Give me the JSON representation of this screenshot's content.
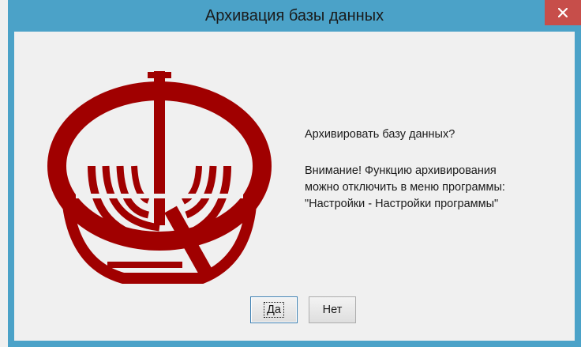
{
  "window": {
    "title": "Архивация базы данных",
    "close_icon": "close-icon"
  },
  "logo": {
    "icon": "database-archive-emblem",
    "color": "#a00000"
  },
  "message": {
    "question": "Архивировать базу данных?",
    "warning_lines": [
      "Внимание! Функцию архивирования",
      "можно отключить в меню программы:",
      "\"Настройки - Настройки программы\""
    ]
  },
  "buttons": {
    "yes_label": "Да",
    "no_label": "Нет"
  },
  "colors": {
    "titlebar": "#4ba2c8",
    "close": "#c74e4a",
    "client": "#f0f0f0"
  }
}
